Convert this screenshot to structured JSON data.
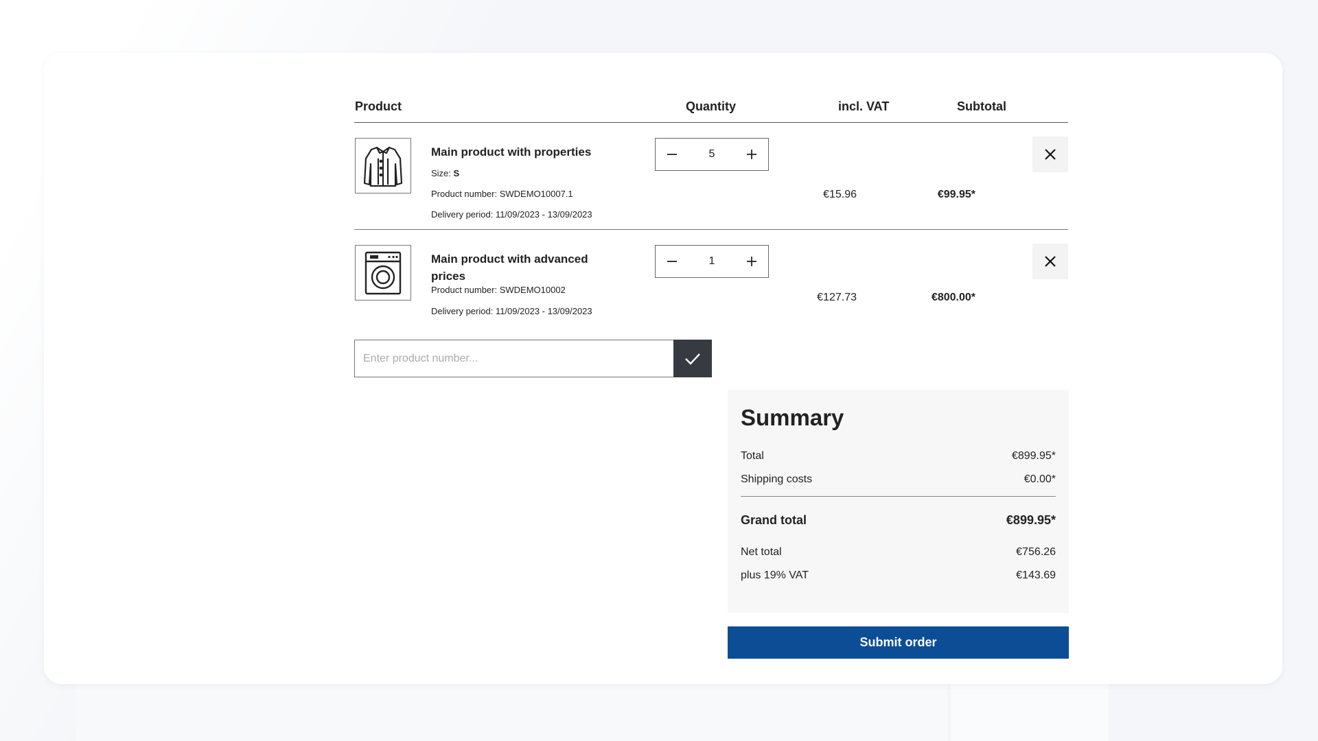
{
  "table": {
    "headers": {
      "product": "Product",
      "quantity": "Quantity",
      "vat": "incl. VAT",
      "subtotal": "Subtotal"
    }
  },
  "items": [
    {
      "name": "Main product with properties",
      "icon": "jacket-icon",
      "size_label": "Size:",
      "size_value": "S",
      "product_number": "Product number: SWDEMO10007.1",
      "delivery": "Delivery period: 11/09/2023 - 13/09/2023",
      "quantity": "5",
      "price_vat": "€15.96",
      "subtotal": "€99.95*"
    },
    {
      "name": "Main product with advanced prices",
      "icon": "washing-machine-icon",
      "product_number": "Product number: SWDEMO10002",
      "delivery": "Delivery period: 11/09/2023 - 13/09/2023",
      "quantity": "1",
      "price_vat": "€127.73",
      "subtotal": "€800.00*"
    }
  ],
  "product_number_form": {
    "placeholder": "Enter product number..."
  },
  "summary": {
    "title": "Summary",
    "total_label": "Total",
    "total_value": "€899.95*",
    "shipping_label": "Shipping costs",
    "shipping_value": "€0.00*",
    "grand_total_label": "Grand total",
    "grand_total_value": "€899.95*",
    "net_total_label": "Net total",
    "net_total_value": "€756.26",
    "vat_label": "plus 19% VAT",
    "vat_value": "€143.69"
  },
  "submit_label": "Submit order",
  "colors": {
    "submit_bg": "#0c4e96",
    "checkmark_bg": "#363b42",
    "summary_bg": "#f7f7f7"
  }
}
